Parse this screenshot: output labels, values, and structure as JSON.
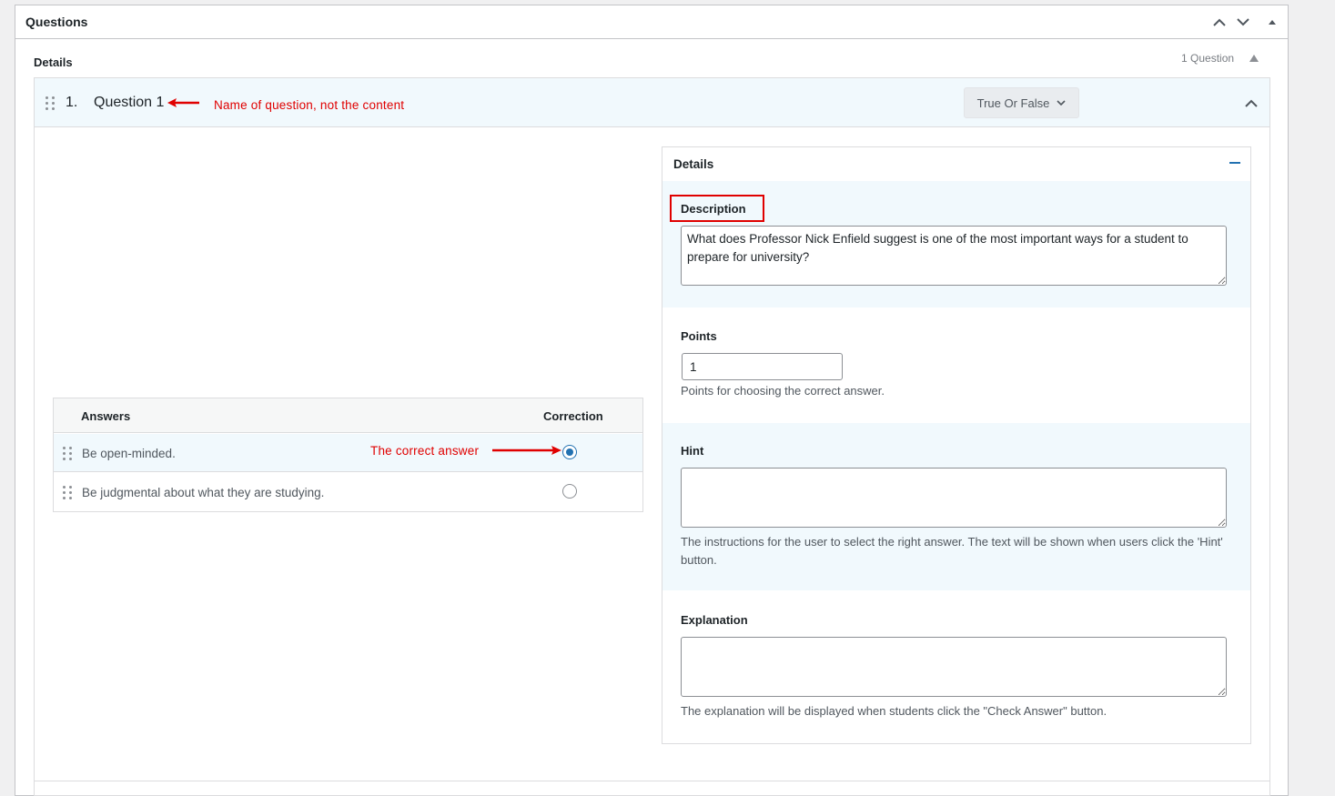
{
  "metabox": {
    "title": "Questions"
  },
  "section": {
    "details_label": "Details",
    "question_count": "1 Question"
  },
  "question": {
    "number": "1.",
    "title": "Question 1",
    "type_label": "True Or False",
    "annotation_name": "Name of question, not the content"
  },
  "answers": {
    "col_answers": "Answers",
    "col_correction": "Correction",
    "rows": [
      {
        "text": "Be open-minded.",
        "correct": true
      },
      {
        "text": "Be judgmental about what they are studying.",
        "correct": false
      }
    ],
    "annotation_correct": "The correct answer"
  },
  "details_panel": {
    "title": "Details",
    "description": {
      "label": "Description",
      "value": "What does Professor Nick Enfield suggest is one of the most important ways for a student to prepare for university?"
    },
    "points": {
      "label": "Points",
      "value": "1",
      "help": "Points for choosing the correct answer."
    },
    "hint": {
      "label": "Hint",
      "value": "",
      "help": "The instructions for the user to select the right answer. The text will be shown when users click the 'Hint' button."
    },
    "explanation": {
      "label": "Explanation",
      "value": "",
      "help": "The explanation will be displayed when students click the \"Check Answer\" button."
    }
  },
  "colors": {
    "accent": "#2271b1",
    "annotation": "#e00000",
    "highlight_bg": "#f1f9fd"
  }
}
